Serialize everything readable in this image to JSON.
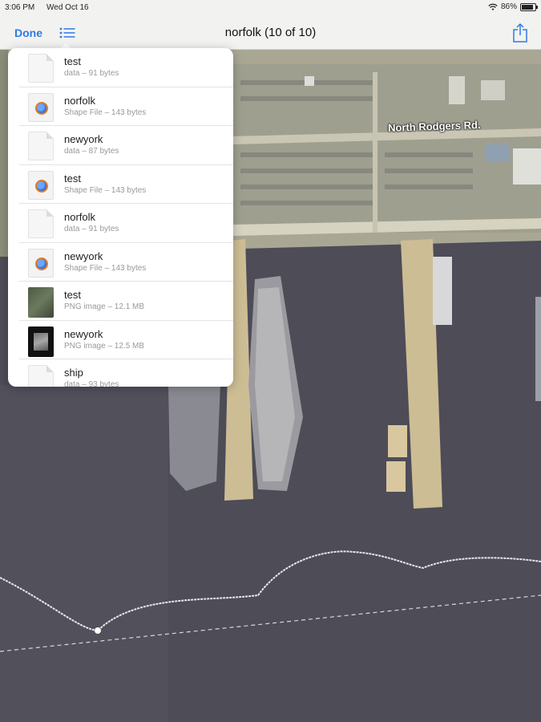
{
  "status_bar": {
    "time": "3:06 PM",
    "date": "Wed Oct 16",
    "battery": "86%",
    "battery_level": 0.86,
    "icons": [
      "wifi-icon",
      "battery-icon"
    ]
  },
  "nav": {
    "done_label": "Done",
    "title": "norfolk (10 of 10)",
    "accent_color": "#2f7ae5",
    "icons": [
      "list-icon",
      "share-icon"
    ]
  },
  "map": {
    "road_label": "North Rodgers Rd."
  },
  "files": [
    {
      "name": "test",
      "meta": "data – 91 bytes",
      "icon": "document-icon"
    },
    {
      "name": "norfolk",
      "meta": "Shape File – 143 bytes",
      "icon": "shapefile-icon"
    },
    {
      "name": "newyork",
      "meta": "data – 87 bytes",
      "icon": "document-icon"
    },
    {
      "name": "test",
      "meta": "Shape File – 143 bytes",
      "icon": "shapefile-icon"
    },
    {
      "name": "norfolk",
      "meta": "data – 91 bytes",
      "icon": "document-icon"
    },
    {
      "name": "newyork",
      "meta": "Shape File – 143 bytes",
      "icon": "shapefile-icon"
    },
    {
      "name": "test",
      "meta": "PNG image – 12.1 MB",
      "icon": "png-thumbnail"
    },
    {
      "name": "newyork",
      "meta": "PNG image – 12.5 MB",
      "icon": "png-thumbnail"
    },
    {
      "name": "ship",
      "meta": "data – 93 bytes",
      "icon": "document-icon"
    }
  ]
}
